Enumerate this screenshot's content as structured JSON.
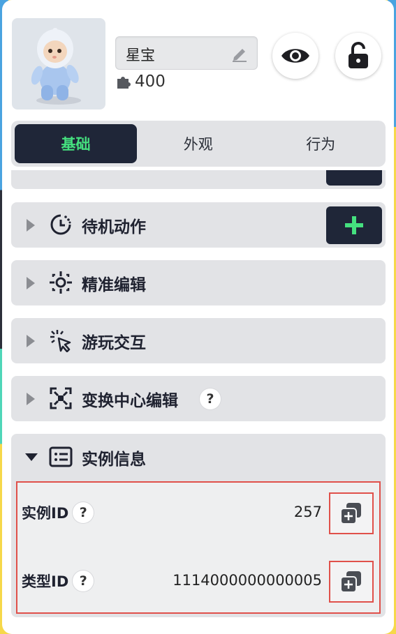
{
  "header": {
    "name": "星宝",
    "coin_count": "400"
  },
  "tabs": [
    {
      "label": "基础",
      "active": true
    },
    {
      "label": "外观",
      "active": false
    },
    {
      "label": "行为",
      "active": false
    }
  ],
  "sections": [
    {
      "label": "待机动作",
      "icon": "clock-dots-icon",
      "has_add": true
    },
    {
      "label": "精准编辑",
      "icon": "crosshair-icon",
      "has_add": false
    },
    {
      "label": "游玩交互",
      "icon": "click-pointer-icon",
      "has_add": false
    },
    {
      "label": "变换中心编辑",
      "icon": "center-target-icon",
      "has_add": false,
      "has_help": true
    }
  ],
  "info": {
    "title": "实例信息",
    "rows": [
      {
        "label": "实例ID",
        "value": "257"
      },
      {
        "label": "类型ID",
        "value": "1114000000000005"
      }
    ]
  },
  "help_glyph": "?",
  "colors": {
    "accent_green": "#45e07f",
    "dark_navy": "#1f2638",
    "highlight_red": "#e0504a"
  }
}
